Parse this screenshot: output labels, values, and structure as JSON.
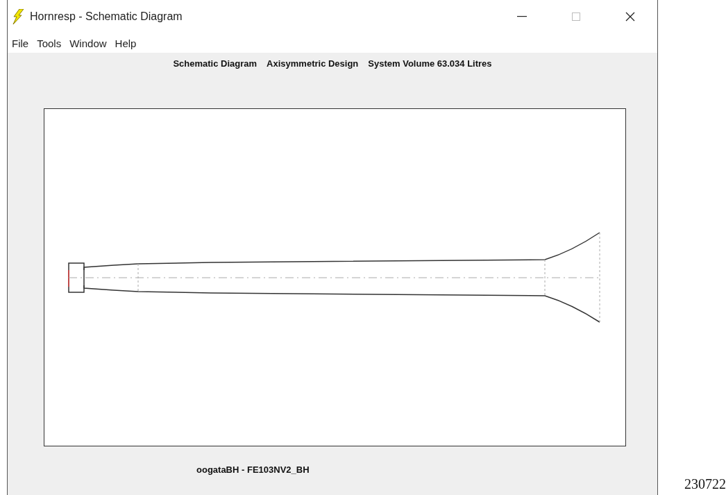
{
  "window": {
    "title": "Hornresp - Schematic Diagram"
  },
  "menu": [
    "File",
    "Tools",
    "Window",
    "Help"
  ],
  "heading": [
    "Schematic Diagram",
    "Axisymmetric Design",
    "System Volume 63.034 Litres"
  ],
  "diagram_caption": "oogataBH - FE103NV2_BH",
  "side_note": "230722"
}
